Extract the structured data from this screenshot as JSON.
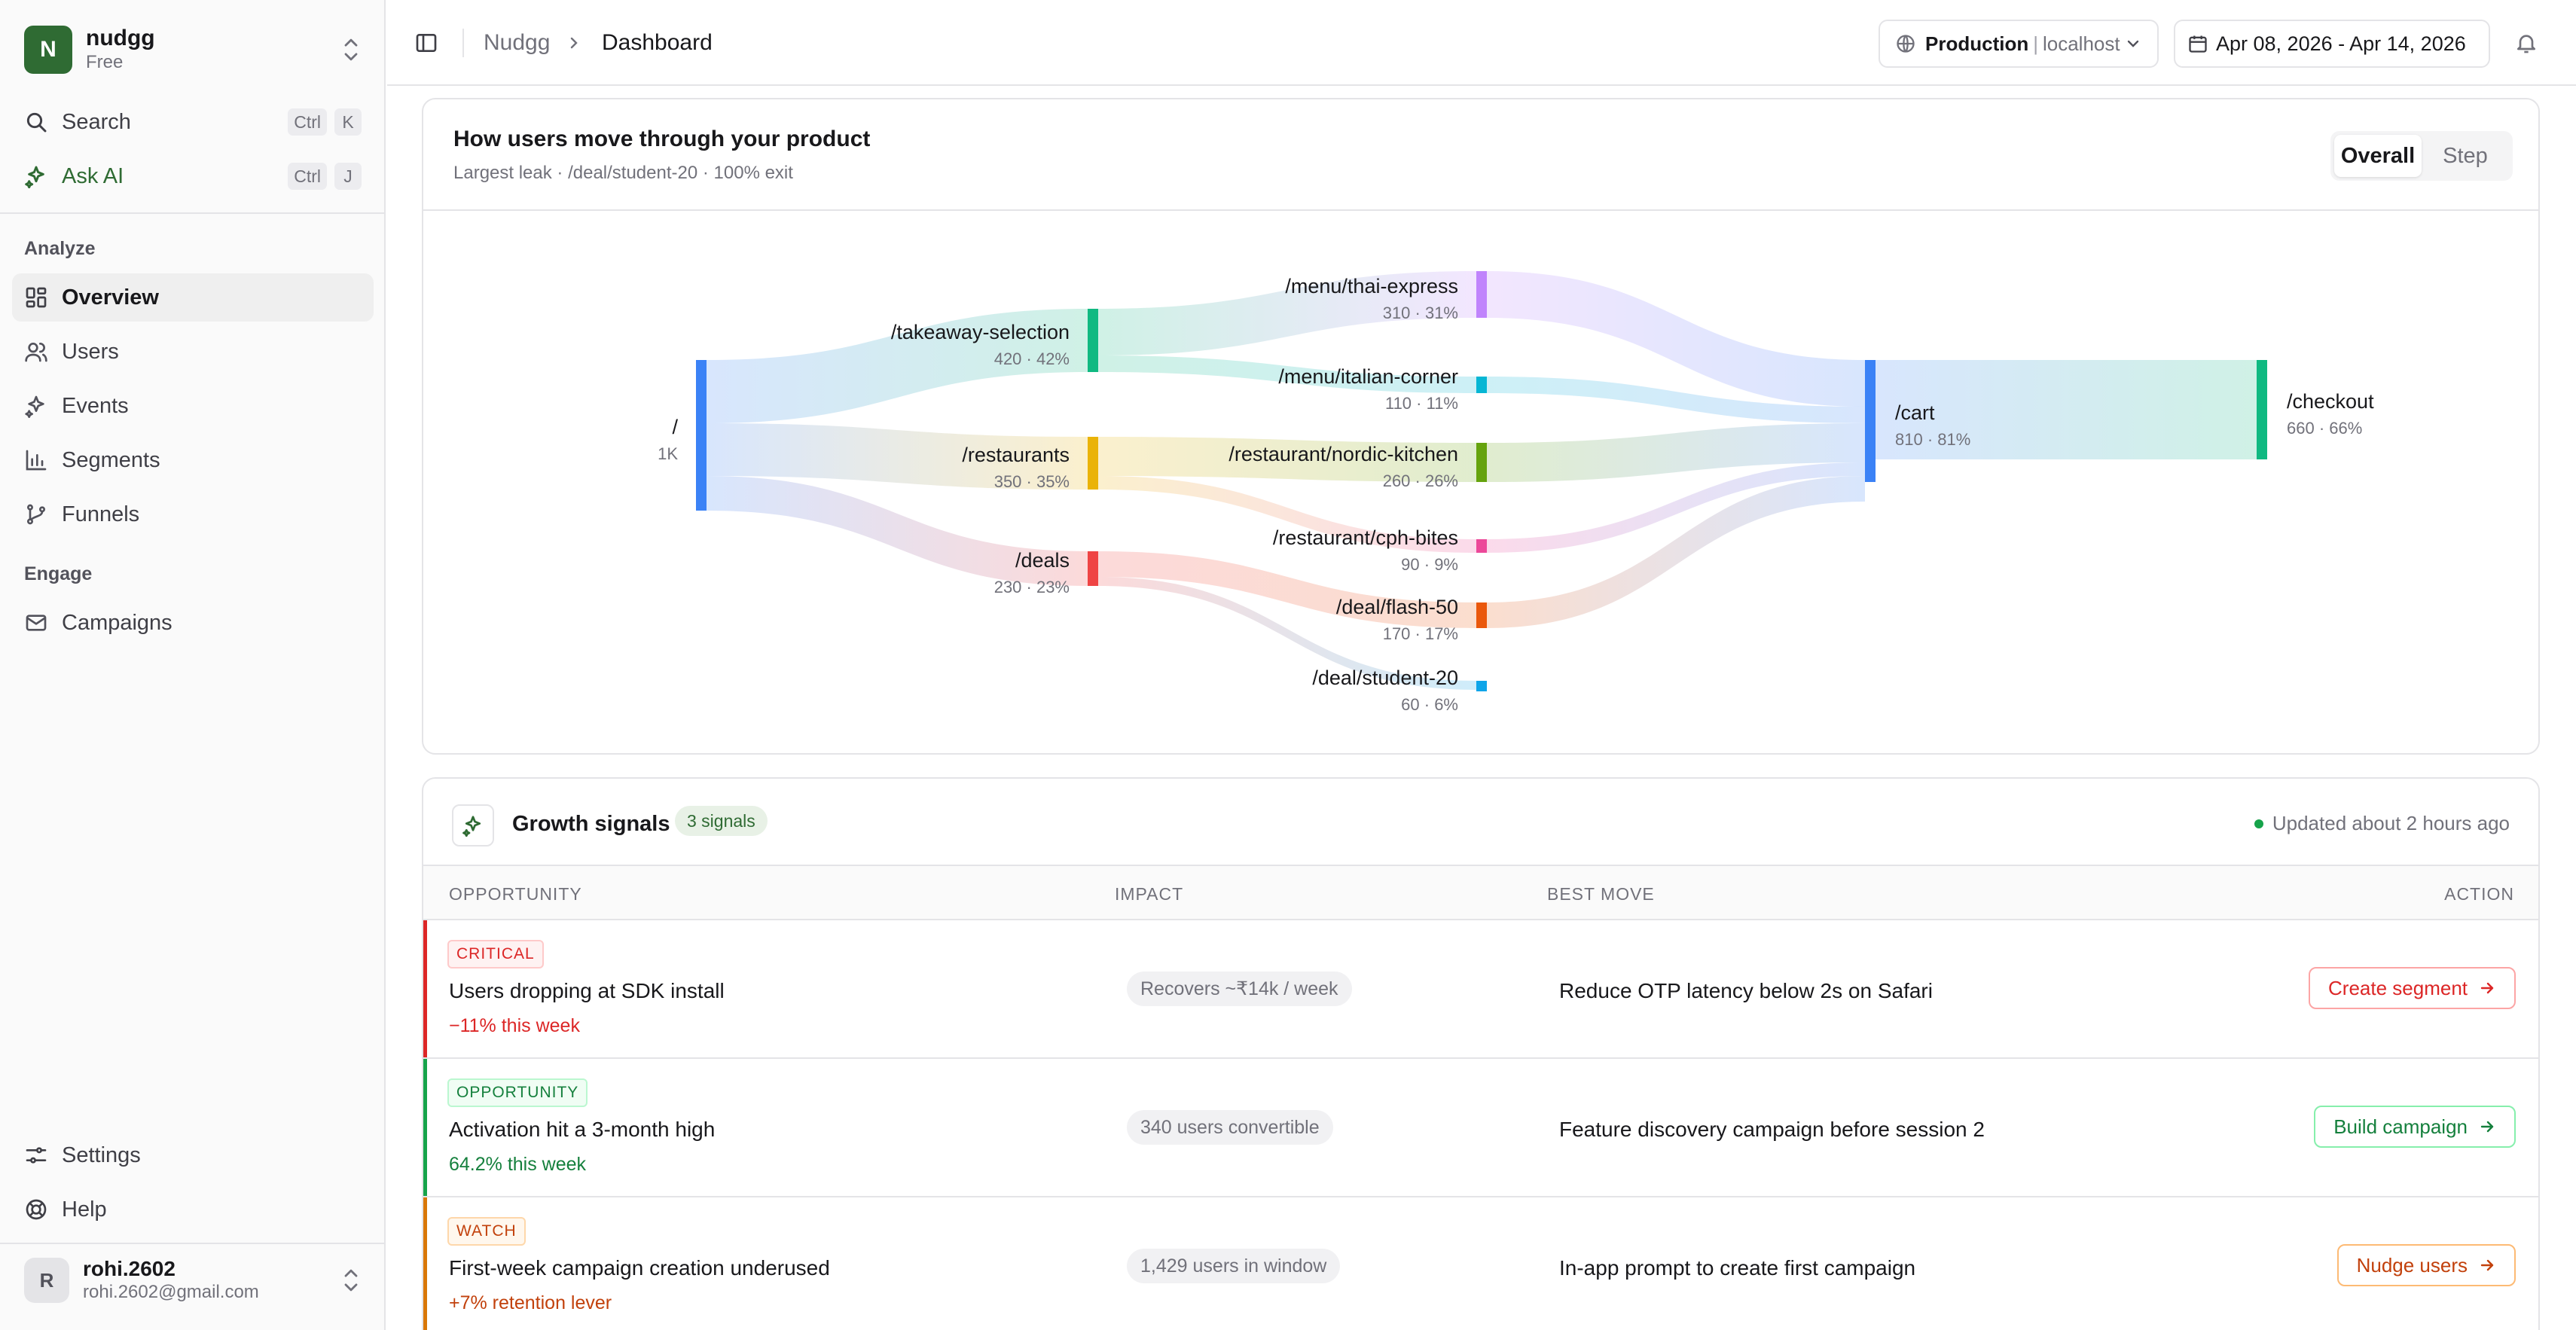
{
  "colors": {
    "brand": "#2f6b33",
    "critical": "#dc2626",
    "opportunity": "#16a34a",
    "watch": "#d97706"
  },
  "workspace": {
    "initial": "N",
    "name": "nudgg",
    "plan": "Free"
  },
  "sidebar": {
    "search_label": "Search",
    "search_keys": [
      "Ctrl",
      "K"
    ],
    "ask_label": "Ask AI",
    "ask_keys": [
      "Ctrl",
      "J"
    ],
    "section_analyze": "Analyze",
    "analyze_items": [
      {
        "label": "Overview",
        "icon": "grid-icon",
        "active": true
      },
      {
        "label": "Users",
        "icon": "users-icon"
      },
      {
        "label": "Events",
        "icon": "sparkle-icon"
      },
      {
        "label": "Segments",
        "icon": "bar-chart-icon"
      },
      {
        "label": "Funnels",
        "icon": "branch-icon"
      }
    ],
    "section_engage": "Engage",
    "engage_items": [
      {
        "label": "Campaigns",
        "icon": "mail-icon"
      }
    ],
    "settings_label": "Settings",
    "help_label": "Help",
    "user": {
      "initial": "R",
      "name": "rohi.2602",
      "email": "rohi.2602@gmail.com"
    }
  },
  "header": {
    "breadcrumb": [
      "Nudgg",
      "Dashboard"
    ],
    "environment": {
      "name": "Production",
      "host": "localhost"
    },
    "date_range": "Apr 08, 2026 - Apr 14, 2026"
  },
  "flow": {
    "title": "How users move through your product",
    "subtitle": "Largest leak · /deal/student-20 · 100% exit",
    "toggle": [
      "Overall",
      "Step"
    ],
    "toggle_selected": "Overall"
  },
  "chart_data": {
    "type": "sankey",
    "nodes": [
      {
        "id": "root",
        "label": "/",
        "sub": "1K",
        "value": 1000,
        "color": "#3b82f6"
      },
      {
        "id": "takeaway",
        "label": "/takeaway-selection",
        "sub": "420 · 42%",
        "value": 420,
        "color": "#10b981"
      },
      {
        "id": "restaurants",
        "label": "/restaurants",
        "sub": "350 · 35%",
        "value": 350,
        "color": "#eab308"
      },
      {
        "id": "deals",
        "label": "/deals",
        "sub": "230 · 23%",
        "value": 230,
        "color": "#ef4444"
      },
      {
        "id": "thai",
        "label": "/menu/thai-express",
        "sub": "310 · 31%",
        "value": 310,
        "color": "#c084fc"
      },
      {
        "id": "italian",
        "label": "/menu/italian-corner",
        "sub": "110 · 11%",
        "value": 110,
        "color": "#06b6d4"
      },
      {
        "id": "nordic",
        "label": "/restaurant/nordic-kitchen",
        "sub": "260 · 26%",
        "value": 260,
        "color": "#65a30d"
      },
      {
        "id": "cph",
        "label": "/restaurant/cph-bites",
        "sub": "90 · 9%",
        "value": 90,
        "color": "#ec4899"
      },
      {
        "id": "flash",
        "label": "/deal/flash-50",
        "sub": "170 · 17%",
        "value": 170,
        "color": "#ea580c"
      },
      {
        "id": "student",
        "label": "/deal/student-20",
        "sub": "60 · 6%",
        "value": 60,
        "color": "#0ea5e9"
      },
      {
        "id": "cart",
        "label": "/cart",
        "sub": "810 · 81%",
        "value": 810,
        "color": "#3b82f6"
      },
      {
        "id": "checkout",
        "label": "/checkout",
        "sub": "660 · 66%",
        "value": 660,
        "color": "#10b981"
      }
    ],
    "links": [
      {
        "source": "root",
        "target": "takeaway",
        "value": 420
      },
      {
        "source": "root",
        "target": "restaurants",
        "value": 350
      },
      {
        "source": "root",
        "target": "deals",
        "value": 230
      },
      {
        "source": "takeaway",
        "target": "thai",
        "value": 310
      },
      {
        "source": "takeaway",
        "target": "italian",
        "value": 110
      },
      {
        "source": "restaurants",
        "target": "nordic",
        "value": 260
      },
      {
        "source": "restaurants",
        "target": "cph",
        "value": 90
      },
      {
        "source": "deals",
        "target": "flash",
        "value": 170
      },
      {
        "source": "deals",
        "target": "student",
        "value": 60
      },
      {
        "source": "thai",
        "target": "cart",
        "value": 310
      },
      {
        "source": "italian",
        "target": "cart",
        "value": 110
      },
      {
        "source": "nordic",
        "target": "cart",
        "value": 260
      },
      {
        "source": "cph",
        "target": "cart",
        "value": 90
      },
      {
        "source": "flash",
        "target": "cart",
        "value": 170
      },
      {
        "source": "cart",
        "target": "checkout",
        "value": 660
      }
    ]
  },
  "signals": {
    "title": "Growth signals",
    "count_label": "3 signals",
    "updated": "Updated about 2 hours ago",
    "columns": [
      "OPPORTUNITY",
      "IMPACT",
      "BEST MOVE",
      "ACTION"
    ],
    "rows": [
      {
        "badge": "CRITICAL",
        "title": "Users dropping at SDK install",
        "delta": "−11% this week",
        "impact": "Recovers ~₹14k / week",
        "move": "Reduce OTP latency below 2s on Safari",
        "action": "Create segment",
        "tone": "critical"
      },
      {
        "badge": "OPPORTUNITY",
        "title": "Activation hit a 3-month high",
        "delta": "64.2% this week",
        "impact": "340 users convertible",
        "move": "Feature discovery campaign before session 2",
        "action": "Build campaign",
        "tone": "opportunity"
      },
      {
        "badge": "WATCH",
        "title": "First-week campaign creation underused",
        "delta": "+7% retention lever",
        "impact": "1,429 users in window",
        "move": "In-app prompt to create first campaign",
        "action": "Nudge users",
        "tone": "watch"
      }
    ]
  }
}
